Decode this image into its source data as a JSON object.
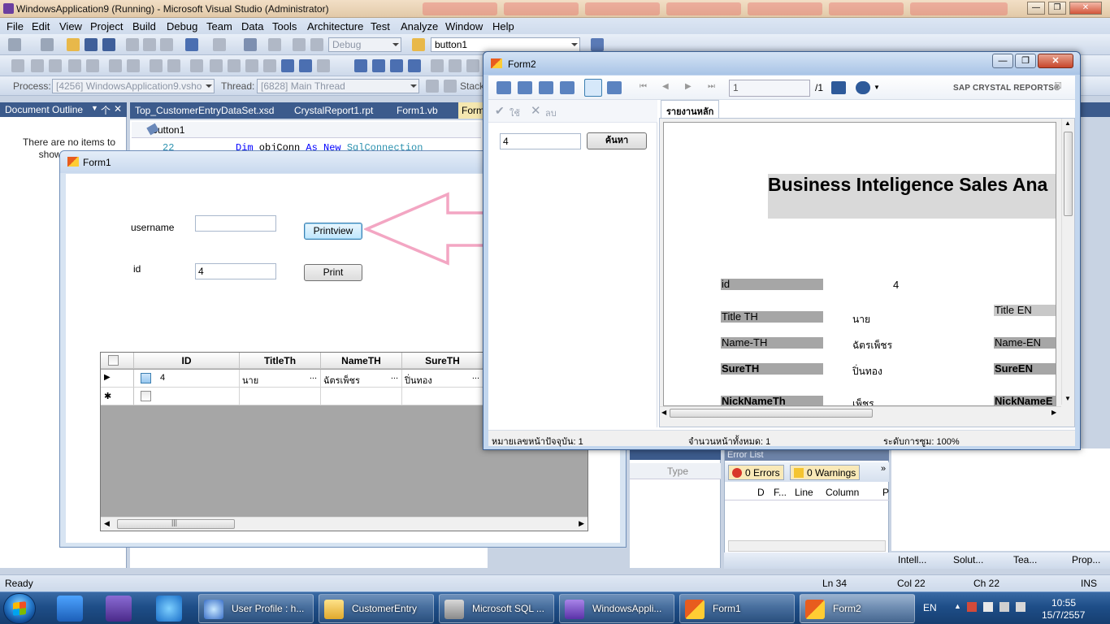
{
  "vs": {
    "title": "WindowsApplication9 (Running) - Microsoft Visual Studio (Administrator)",
    "menu": [
      "File",
      "Edit",
      "View",
      "Project",
      "Build",
      "Debug",
      "Team",
      "Data",
      "Tools",
      "Architecture",
      "Test",
      "Analyze",
      "Window",
      "Help"
    ],
    "toolbar": {
      "config": "Debug",
      "object": "button1",
      "process_label": "Process:",
      "process_value": "[4256] WindowsApplication9.vsho",
      "thread_label": "Thread:",
      "thread_value": "[6828] Main Thread",
      "stack_label": "Stack"
    },
    "doc_outline": {
      "title": "Document Outline",
      "pin": "个",
      "close": "✕",
      "message": "There are no items to show for docu"
    },
    "tabs": [
      "Top_CustomerEntryDataSet.xsd",
      "CrystalReport1.rpt",
      "Form1.vb",
      "Form"
    ],
    "editor": {
      "nav": "Button1",
      "lines": [
        {
          "num": "22",
          "kw1": "Dim",
          "name": " objConn ",
          "kw2": "As New",
          "type": " SqlConnection"
        }
      ]
    },
    "status": {
      "ready": "Ready",
      "ln": "Ln 34",
      "col": "Col 22",
      "ch": "Ch 22",
      "ins": "INS"
    },
    "props": {
      "type_label": "Type"
    },
    "error_list": {
      "title": "Error List",
      "errors": "0 Errors",
      "warnings": "0 Warnings",
      "more": "»",
      "columns": [
        "D",
        "F...",
        "Line",
        "Column",
        "P"
      ]
    },
    "bottom_tabs": [
      "Intell...",
      "Solut...",
      "Tea...",
      "Prop..."
    ]
  },
  "form1": {
    "title": "Form1",
    "username_label": "username",
    "username_value": "",
    "id_label": "id",
    "id_value": "4",
    "printview_label": "Printview",
    "print_label": "Print",
    "grid": {
      "columns": [
        "ID",
        "TitleTh",
        "NameTH",
        "SureTH"
      ],
      "rows": [
        {
          "id": "4",
          "title": "นาย",
          "name": "ฉัตรเพ็ชร",
          "sure": "ปิ่นทอง"
        }
      ],
      "cell_more": "...",
      "current_marker": "▶",
      "new_marker": "✱",
      "scroll_grip": "|||"
    }
  },
  "form2": {
    "title": "Form2",
    "brand": "SAP CRYSTAL REPORTS®",
    "page_input": "1",
    "page_total": "/1",
    "apply_label": "ใช้",
    "delete_label": "ลบ",
    "param_value": "4",
    "search_label": "ค้นหา",
    "main_tab": "รายงานหลัก",
    "report": {
      "title": "Business Inteligence Sales Ana",
      "fields": {
        "id": "id",
        "id_value": "4",
        "title_th": "Title TH",
        "title_th_value": "นาย",
        "title_en": "Title EN",
        "name_th": "Name-TH",
        "name_th_value": "ฉัตรเพ็ชร",
        "name_en": "Name-EN",
        "sure_th": "SureTH",
        "sure_th_value": "ปิ่นทอง",
        "sure_en": "SureEN",
        "nick_th": "NickNameTh",
        "nick_th_value": "เพ็ชร",
        "nick_en": "NickNameE"
      }
    },
    "status": {
      "current_page": "หมายเลขหน้าปัจจุบัน: 1",
      "total_pages": "จำนวนหน้าทั้งหมด: 1",
      "zoom": "ระดับการซูม: 100%"
    }
  },
  "taskbar": {
    "items": [
      "User Profile : h...",
      "CustomerEntry",
      "Microsoft SQL ...",
      "WindowsAppli...",
      "Form1",
      "Form2"
    ],
    "lang": "EN",
    "time": "10:55",
    "date": "15/7/2557"
  }
}
